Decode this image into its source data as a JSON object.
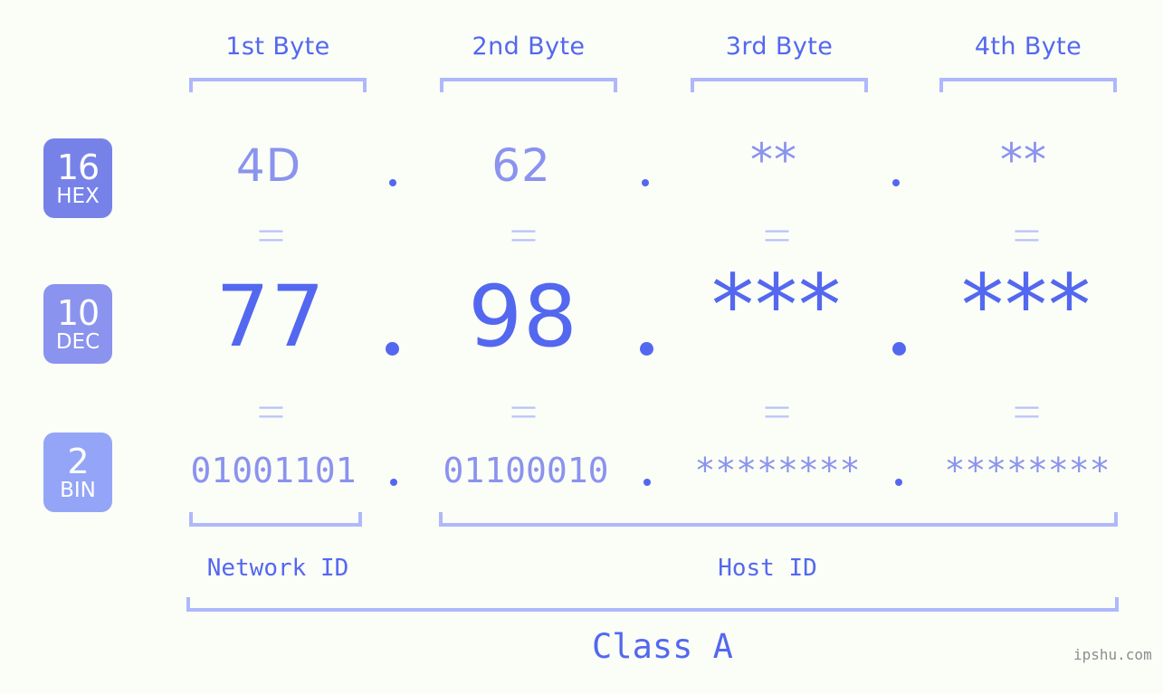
{
  "meta": {
    "background_color": "#fbfdf7",
    "accent_color": "#5368ef",
    "accent_light_color": "#8a93ee",
    "bracket_color": "#aeb8fb",
    "watermark": "ipshu.com"
  },
  "byte_headers": [
    {
      "label": "1st Byte"
    },
    {
      "label": "2nd Byte"
    },
    {
      "label": "3rd Byte"
    },
    {
      "label": "4th Byte"
    }
  ],
  "radix_badges": [
    {
      "number": "16",
      "label": "HEX",
      "color": "#7782e8"
    },
    {
      "number": "10",
      "label": "DEC",
      "color": "#8a93ee"
    },
    {
      "number": "2",
      "label": "BIN",
      "color": "#94a5f7"
    }
  ],
  "rows": {
    "hex": {
      "values": [
        "4D",
        "62",
        "**",
        "**"
      ]
    },
    "dec": {
      "values": [
        "77",
        "98",
        "***",
        "***"
      ]
    },
    "bin": {
      "values": [
        "01001101",
        "01100010",
        "********",
        "********"
      ]
    }
  },
  "separator": ".",
  "equals_symbol": "||",
  "segments": {
    "network_id": "Network ID",
    "host_id": "Host ID",
    "ip_class": "Class A"
  }
}
